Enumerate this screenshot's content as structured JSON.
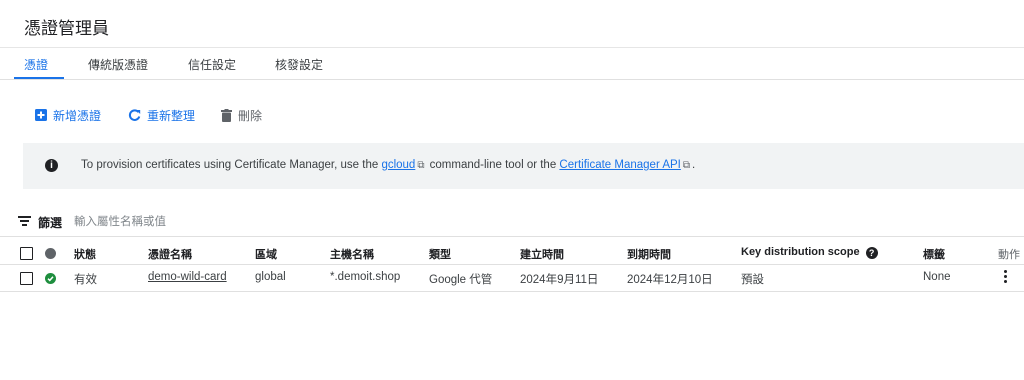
{
  "header": {
    "title": "憑證管理員"
  },
  "tabs": [
    {
      "label": "憑證",
      "active": true
    },
    {
      "label": "傳統版憑證",
      "active": false
    },
    {
      "label": "信任設定",
      "active": false
    },
    {
      "label": "核發設定",
      "active": false
    }
  ],
  "toolbar": {
    "add_label": "新增憑證",
    "refresh_label": "重新整理",
    "delete_label": "刪除"
  },
  "banner": {
    "text_before": "To provision certificates using Certificate Manager, use the ",
    "link1": "gcloud",
    "text_middle": " command-line tool or the ",
    "link2": "Certificate Manager API",
    "text_after": "."
  },
  "filter": {
    "label": "篩選",
    "placeholder": "輸入屬性名稱或值"
  },
  "table": {
    "columns": {
      "status": "狀態",
      "name": "憑證名稱",
      "region": "區域",
      "hostname": "主機名稱",
      "type": "類型",
      "created": "建立時間",
      "expires": "到期時間",
      "scope": "Key distribution scope",
      "labels": "標籤",
      "actions": "動作"
    },
    "rows": [
      {
        "status": "有效",
        "name": "demo-wild-card",
        "region": "global",
        "hostname": "*.demoit.shop",
        "type": "Google 代管",
        "created": "2024年9月11日",
        "expires": "2024年12月10日",
        "scope": "預設",
        "labels": "None"
      }
    ]
  },
  "colors": {
    "accent": "#1a73e8",
    "success": "#1e8e3e",
    "link_visited": "#7b1fa2"
  }
}
